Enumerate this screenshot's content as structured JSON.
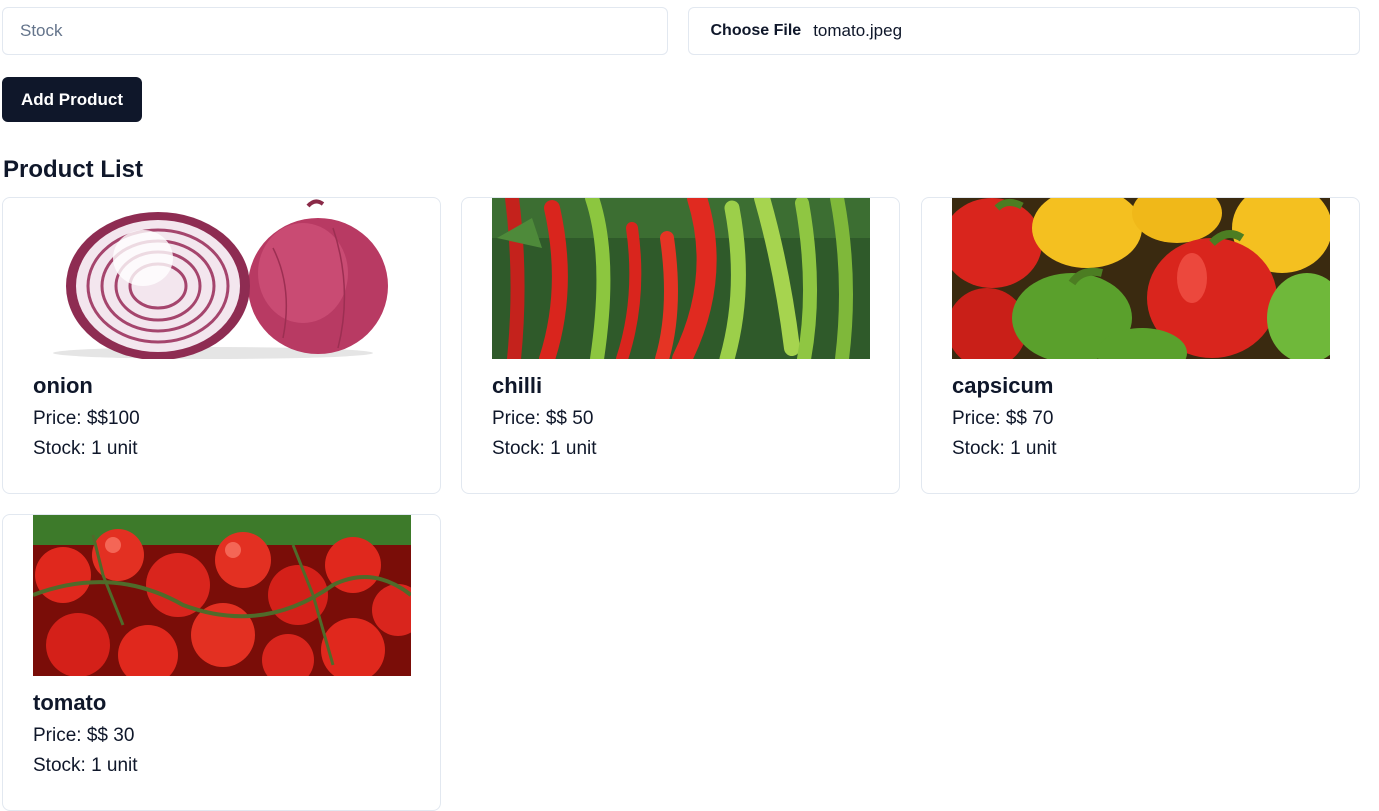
{
  "form": {
    "stock_placeholder": "Stock",
    "stock_value": "",
    "choose_file_label": "Choose File",
    "file_name": "tomato.jpeg",
    "add_button_label": "Add Product"
  },
  "product_list": {
    "title": "Product List",
    "items": [
      {
        "name": "onion",
        "price_text": "Price: $$100",
        "stock_text": "Stock: 1 unit",
        "image": "onion-photo"
      },
      {
        "name": "chilli",
        "price_text": "Price: $$ 50",
        "stock_text": "Stock: 1 unit",
        "image": "chilli-photo"
      },
      {
        "name": "capsicum",
        "price_text": "Price: $$ 70",
        "stock_text": "Stock: 1 unit",
        "image": "capsicum-photo"
      },
      {
        "name": "tomato",
        "price_text": "Price: $$ 30",
        "stock_text": "Stock: 1 unit",
        "image": "tomato-photo"
      }
    ]
  },
  "colors": {
    "primary": "#0f172a",
    "border": "#e2e8f0",
    "placeholder": "#64748b"
  }
}
